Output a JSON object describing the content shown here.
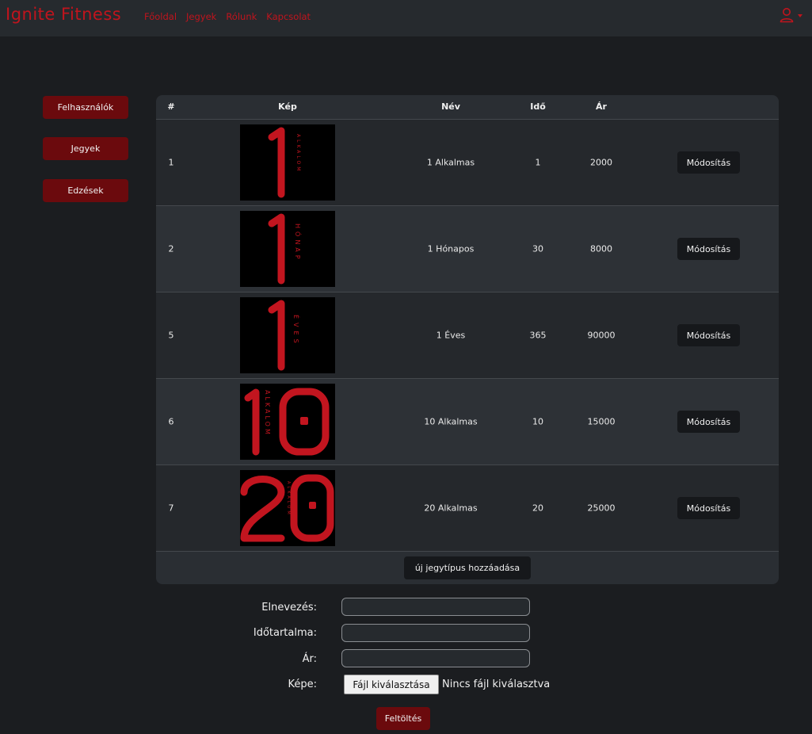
{
  "brand": "Ignite Fitness",
  "nav": [
    "Főoldal",
    "Jegyek",
    "Rólunk",
    "Kapcsolat"
  ],
  "colors": {
    "accent": "#c0141d",
    "button_dark_red": "#6b0a0d",
    "background": "#1b1d20",
    "navbar": "#262a2e"
  },
  "sidebar": {
    "items": [
      "Felhasználók",
      "Jegyek",
      "Edzések"
    ]
  },
  "table": {
    "headers": {
      "index": "#",
      "image": "Kép",
      "name": "Név",
      "duration": "Idő",
      "price": "Ár"
    },
    "rows": [
      {
        "id": "1",
        "name": "1 Alkalmas",
        "duration": "1",
        "price": "2000",
        "img_big": "1",
        "img_small": "ALKALOM"
      },
      {
        "id": "2",
        "name": "1 Hónapos",
        "duration": "30",
        "price": "8000",
        "img_big": "1",
        "img_small": "HÓNAP"
      },
      {
        "id": "5",
        "name": "1 Éves",
        "duration": "365",
        "price": "90000",
        "img_big": "1",
        "img_small": "ÉVES"
      },
      {
        "id": "6",
        "name": "10 Alkalmas",
        "duration": "10",
        "price": "15000",
        "img_big": "10",
        "img_small": "ALKALOM"
      },
      {
        "id": "7",
        "name": "20 Alkalmas",
        "duration": "20",
        "price": "25000",
        "img_big": "20",
        "img_small": "ALKALOM"
      }
    ],
    "edit_label": "Módosítás",
    "add_label": "új jegytípus hozzáadása"
  },
  "form": {
    "name_label": "Elnevezés:",
    "duration_label": "Időtartalma:",
    "price_label": "Ár:",
    "image_label": "Képe:",
    "name_value": "",
    "duration_value": "",
    "price_value": "",
    "file_button": "Fájl kiválasztása",
    "file_status": "Nincs fájl kiválasztva",
    "submit": "Feltöltés"
  },
  "icons": {
    "user": "user-icon",
    "dropdown": "caret-down-icon"
  }
}
